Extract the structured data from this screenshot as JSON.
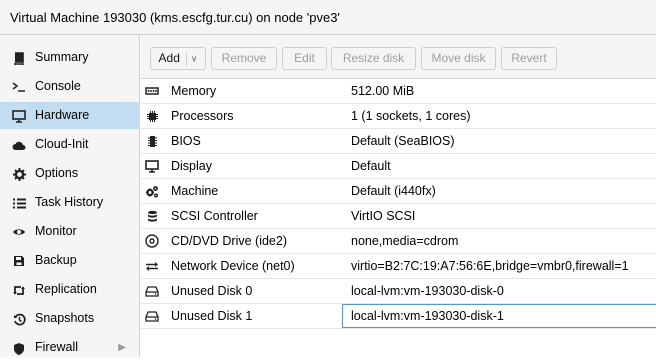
{
  "window": {
    "title": "Virtual Machine 193030 (kms.escfg.tur.cu) on node 'pve3'"
  },
  "sidebar": {
    "items": [
      {
        "label": "Summary",
        "icon": "book-icon",
        "active": false
      },
      {
        "label": "Console",
        "icon": "terminal-icon",
        "active": false
      },
      {
        "label": "Hardware",
        "icon": "monitor-icon",
        "active": true
      },
      {
        "label": "Cloud-Init",
        "icon": "cloud-icon",
        "active": false
      },
      {
        "label": "Options",
        "icon": "gear-icon",
        "active": false
      },
      {
        "label": "Task History",
        "icon": "list-icon",
        "active": false
      },
      {
        "label": "Monitor",
        "icon": "eye-icon",
        "active": false
      },
      {
        "label": "Backup",
        "icon": "floppy-icon",
        "active": false
      },
      {
        "label": "Replication",
        "icon": "retweet-icon",
        "active": false
      },
      {
        "label": "Snapshots",
        "icon": "history-icon",
        "active": false
      },
      {
        "label": "Firewall",
        "icon": "shield-icon",
        "active": false
      }
    ]
  },
  "toolbar": {
    "add_label": "Add",
    "remove_label": "Remove",
    "edit_label": "Edit",
    "resize_label": "Resize disk",
    "move_label": "Move disk",
    "revert_label": "Revert"
  },
  "hardware": {
    "rows": [
      {
        "label": "Memory",
        "value": "512.00 MiB",
        "icon": "memory-icon"
      },
      {
        "label": "Processors",
        "value": "1 (1 sockets, 1 cores)",
        "icon": "cpu-icon"
      },
      {
        "label": "BIOS",
        "value": "Default (SeaBIOS)",
        "icon": "microchip-icon"
      },
      {
        "label": "Display",
        "value": "Default",
        "icon": "desktop-icon"
      },
      {
        "label": "Machine",
        "value": "Default (i440fx)",
        "icon": "cogs-icon"
      },
      {
        "label": "SCSI Controller",
        "value": "VirtIO SCSI",
        "icon": "database-icon"
      },
      {
        "label": "CD/DVD Drive (ide2)",
        "value": "none,media=cdrom",
        "icon": "cdrom-icon"
      },
      {
        "label": "Network Device (net0)",
        "value": "virtio=B2:7C:19:A7:56:6E,bridge=vmbr0,firewall=1",
        "icon": "exchange-icon"
      },
      {
        "label": "Unused Disk 0",
        "value": "local-lvm:vm-193030-disk-0",
        "icon": "hdd-icon"
      },
      {
        "label": "Unused Disk 1",
        "value": "local-lvm:vm-193030-disk-1",
        "icon": "hdd-icon"
      }
    ]
  }
}
